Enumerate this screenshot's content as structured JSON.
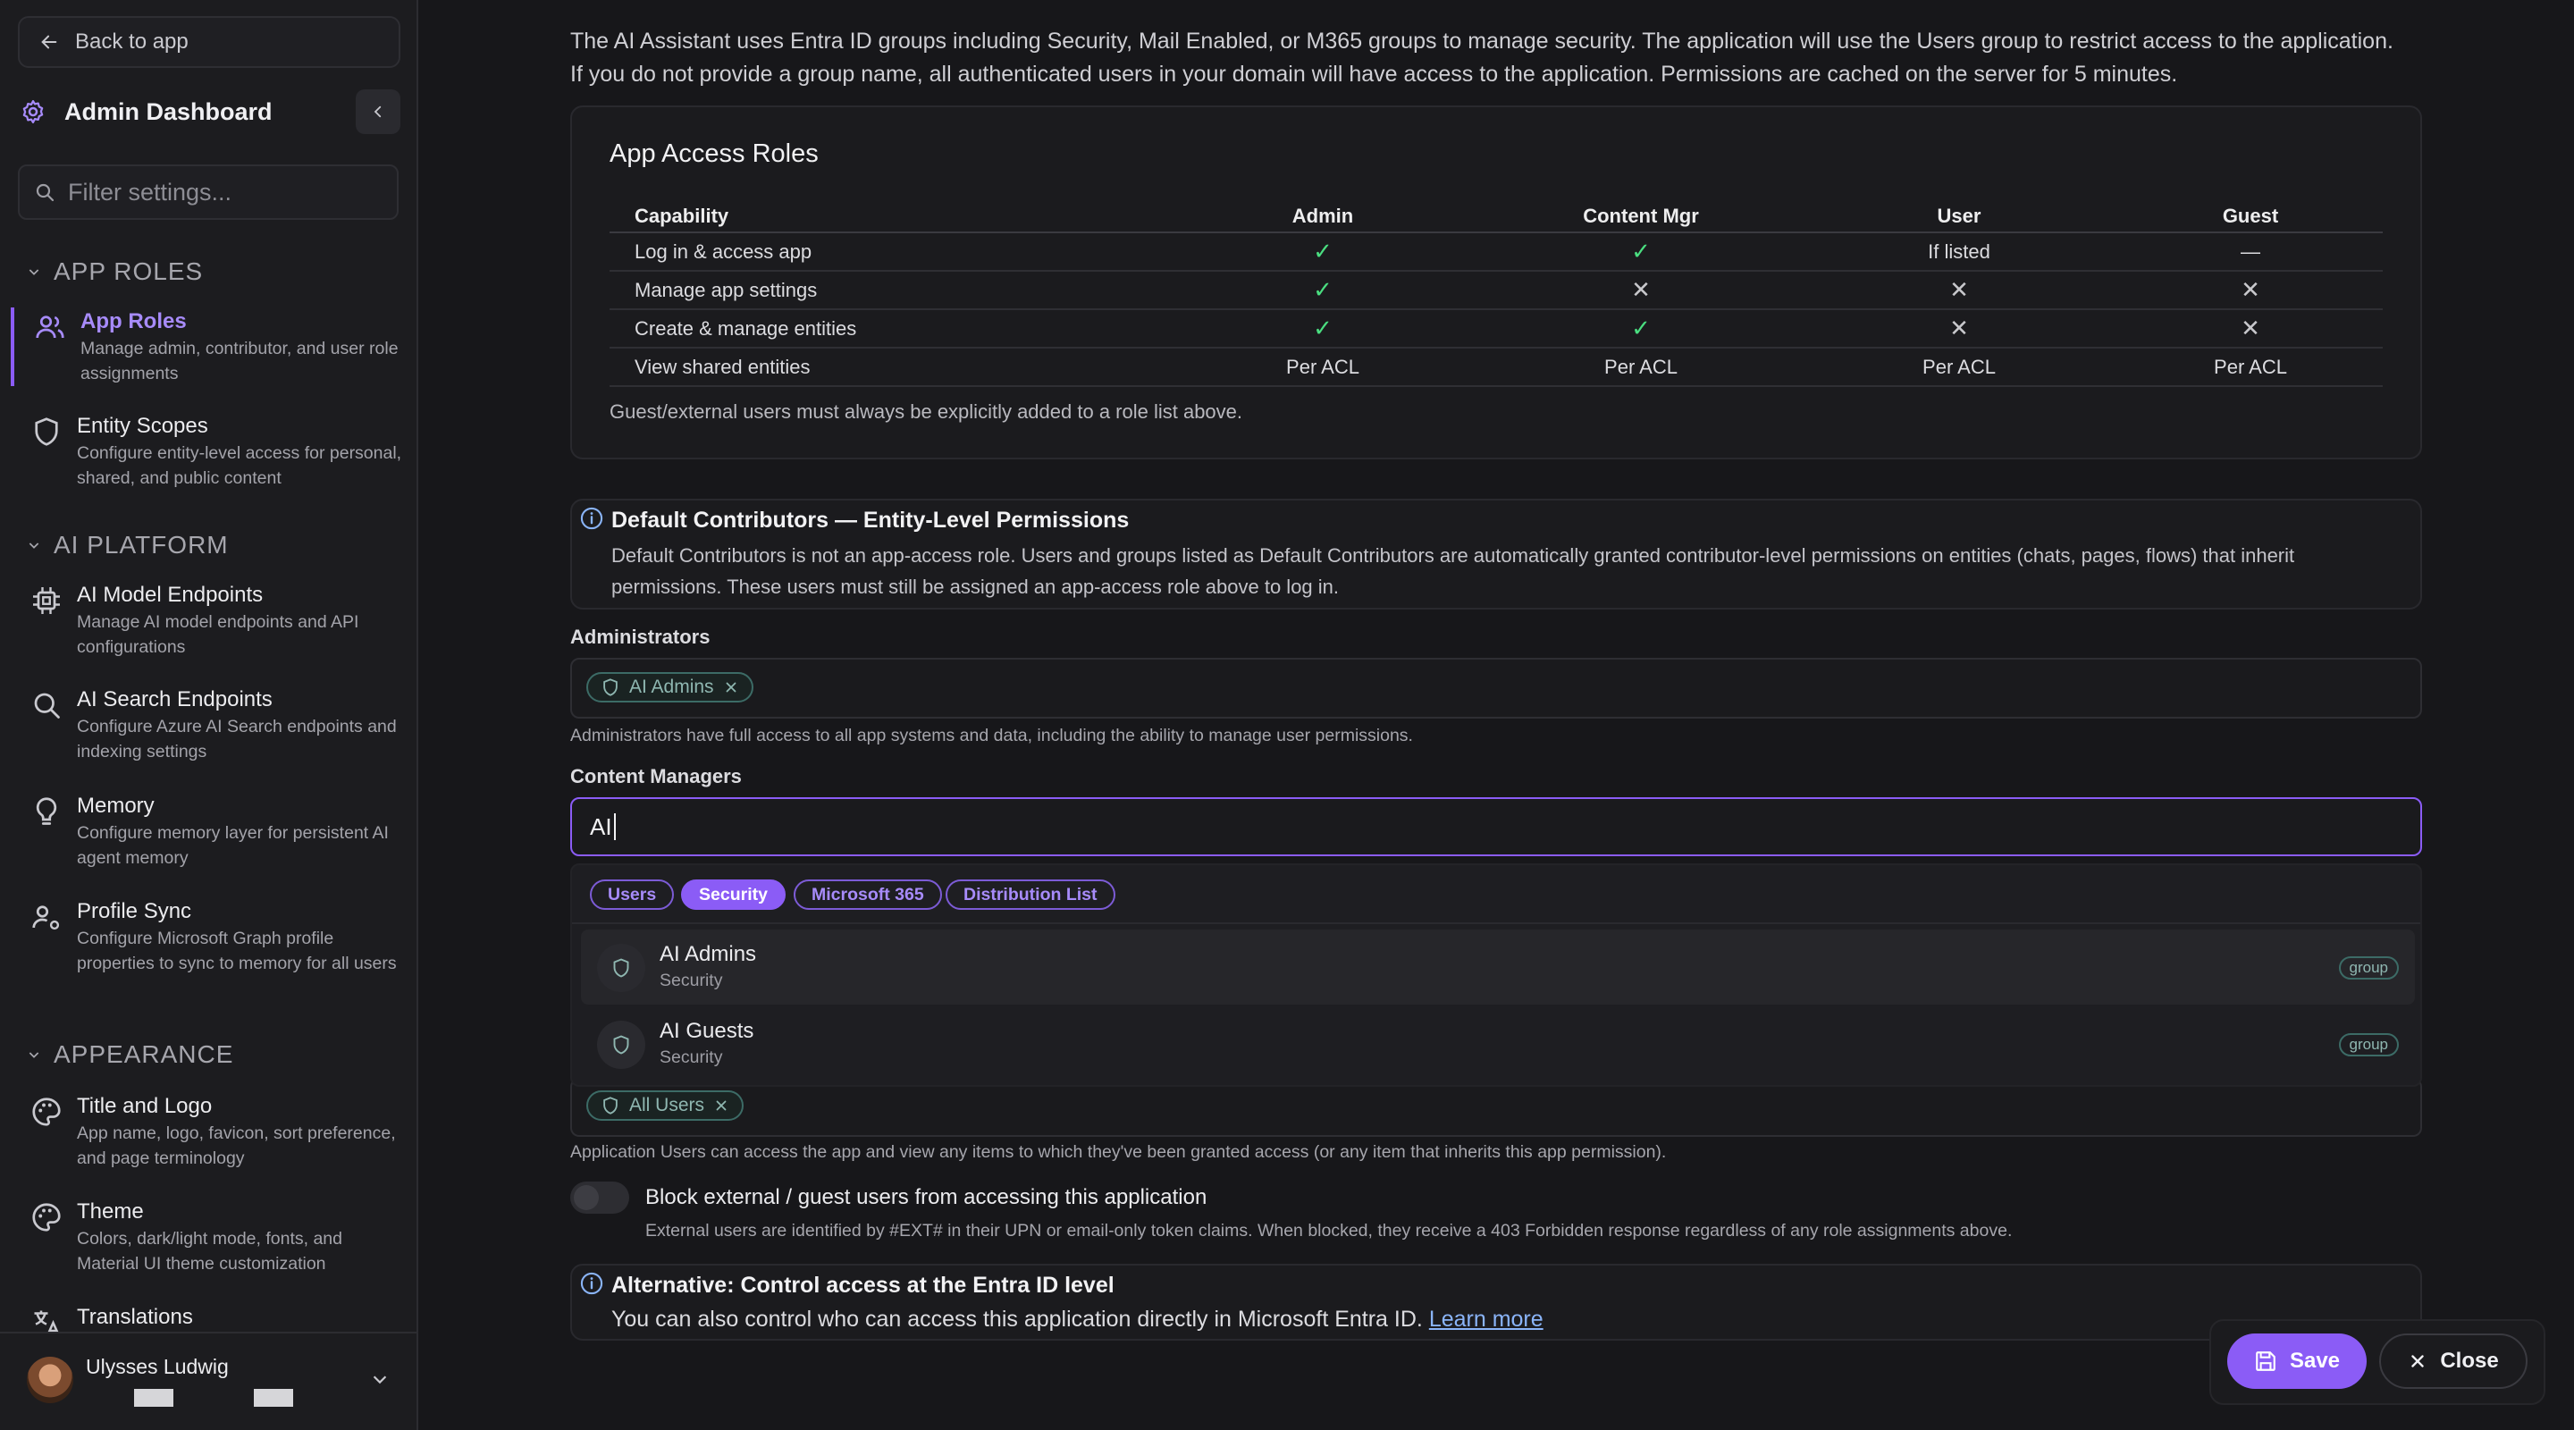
{
  "sidebar": {
    "back_label": "Back to app",
    "title": "Admin Dashboard",
    "filter_placeholder": "Filter settings...",
    "sections": {
      "app_roles": "APP ROLES",
      "ai_platform": "AI PLATFORM",
      "appearance": "APPEARANCE"
    },
    "items": [
      {
        "title": "App Roles",
        "desc": "Manage admin, contributor, and user role assignments"
      },
      {
        "title": "Entity Scopes",
        "desc": "Configure entity-level access for personal, shared, and public content"
      },
      {
        "title": "AI Model Endpoints",
        "desc": "Manage AI model endpoints and API configurations"
      },
      {
        "title": "AI Search Endpoints",
        "desc": "Configure Azure AI Search endpoints and indexing settings"
      },
      {
        "title": "Memory",
        "desc": "Configure memory layer for persistent AI agent memory"
      },
      {
        "title": "Profile Sync",
        "desc": "Configure Microsoft Graph profile properties to sync to memory for all users"
      },
      {
        "title": "Title and Logo",
        "desc": "App name, logo, favicon, sort preference, and page terminology"
      },
      {
        "title": "Theme",
        "desc": "Colors, dark/light mode, fonts, and Material UI theme customization"
      },
      {
        "title": "Translations",
        "desc": ""
      }
    ],
    "user": {
      "name": "Ulysses Ludwig"
    }
  },
  "main": {
    "intro": "The AI Assistant uses Entra ID groups including Security, Mail Enabled, or M365 groups to manage security. The application will use the Users group to restrict access to the application. If you do not provide a group name, all authenticated users in your domain will have access to the application. Permissions are cached on the server for 5 minutes.",
    "roles_card": {
      "title": "App Access Roles",
      "headers": [
        "Capability",
        "Admin",
        "Content Mgr",
        "User",
        "Guest"
      ],
      "rows": [
        {
          "cap": "Log in & access app",
          "admin": "check",
          "content": "check",
          "user": "If listed",
          "guest": "—"
        },
        {
          "cap": "Manage app settings",
          "admin": "check",
          "content": "x",
          "user": "x",
          "guest": "x"
        },
        {
          "cap": "Create & manage entities",
          "admin": "check",
          "content": "check",
          "user": "x",
          "guest": "x"
        },
        {
          "cap": "View shared entities",
          "admin": "Per ACL",
          "content": "Per ACL",
          "user": "Per ACL",
          "guest": "Per ACL"
        }
      ],
      "note": "Guest/external users must always be explicitly added to a role list above."
    },
    "default_contrib": {
      "title": "Default Contributors — Entity-Level Permissions",
      "body": "Default Contributors is not an app-access role. Users and groups listed as Default Contributors are automatically granted contributor-level permissions on entities (chats, pages, flows) that inherit permissions. These users must still be assigned an app-access role above to log in."
    },
    "administrators": {
      "label": "Administrators",
      "chips": [
        "AI Admins"
      ],
      "help": "Administrators have full access to all app systems and data, including the ability to manage user permissions."
    },
    "content_managers": {
      "label": "Content Managers",
      "value": "AI"
    },
    "dropdown": {
      "filters": [
        "Users",
        "Security",
        "Microsoft 365",
        "Distribution List"
      ],
      "active_filter": "Security",
      "results": [
        {
          "name": "AI Admins",
          "type": "Security",
          "badge": "group"
        },
        {
          "name": "AI Guests",
          "type": "Security",
          "badge": "group"
        }
      ]
    },
    "users_field": {
      "chips": [
        "All Users"
      ],
      "help": "Application Users can access the app and view any items to which they've been granted access (or any item that inherits this app permission)."
    },
    "block_external": {
      "label": "Block external / guest users from accessing this application",
      "help": "External users are identified by #EXT# in their UPN or email-only token claims. When blocked, they receive a 403 Forbidden response regardless of any role assignments above.",
      "enabled": false
    },
    "alternative": {
      "title": "Alternative: Control access at the Entra ID level",
      "body": "You can also control who can access this application directly in Microsoft Entra ID.",
      "link": "Learn more"
    },
    "actions": {
      "save": "Save",
      "close": "Close"
    }
  },
  "colors": {
    "accent": "#8b5cf6",
    "success": "#4ade80",
    "chip": "#3c6b66"
  }
}
